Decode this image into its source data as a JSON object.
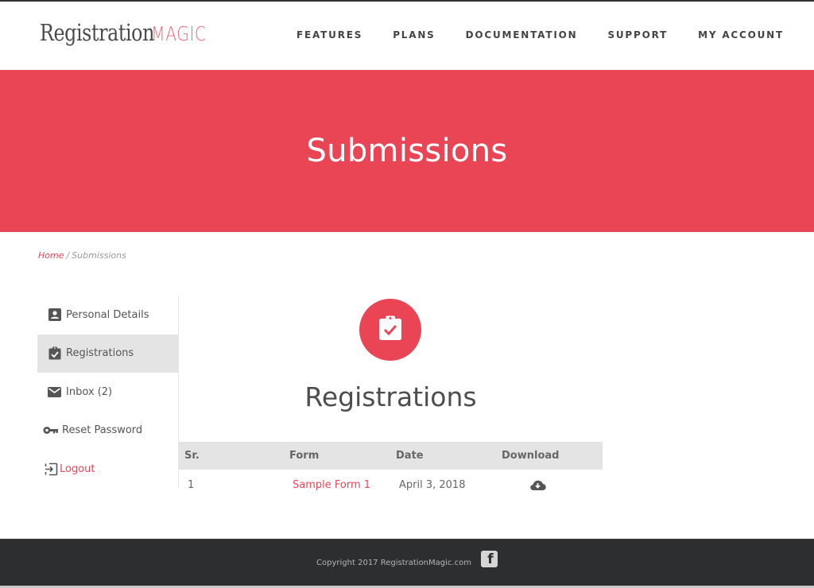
{
  "header": {
    "logo_main": "Registration",
    "logo_accent": "MAGIC",
    "nav": [
      {
        "label": "FEATURES"
      },
      {
        "label": "PLANS"
      },
      {
        "label": "DOCUMENTATION"
      },
      {
        "label": "SUPPORT"
      },
      {
        "label": "MY ACCOUNT"
      }
    ]
  },
  "banner": {
    "title": "Submissions"
  },
  "breadcrumb": {
    "home": "Home",
    "separator": "/",
    "current": "Submissions"
  },
  "sidebar": {
    "items": [
      {
        "label": "Personal Details",
        "icon": "account-box-icon",
        "active": false
      },
      {
        "label": "Registrations",
        "icon": "clipboard-check-icon",
        "active": true
      },
      {
        "label": "Inbox (2)",
        "icon": "mail-icon",
        "active": false
      },
      {
        "label": "Reset Password",
        "icon": "key-icon",
        "active": false
      },
      {
        "label": "Logout",
        "icon": "exit-icon",
        "active": false
      }
    ]
  },
  "main": {
    "icon": "clipboard-check-icon",
    "title": "Registrations",
    "table": {
      "columns": [
        "Sr.",
        "Form",
        "Date",
        "Download"
      ],
      "rows": [
        {
          "sr": "1",
          "form": "Sample Form 1",
          "date": "April 3, 2018",
          "download_icon": "cloud-download-icon"
        }
      ]
    }
  },
  "footer": {
    "copyright": "Copyright 2017 RegistrationMagic.com",
    "social_icon": "facebook-icon"
  },
  "colors": {
    "accent": "#e94555",
    "footer_bg": "#2d2e30",
    "active_item_bg": "#e4e4e4"
  }
}
